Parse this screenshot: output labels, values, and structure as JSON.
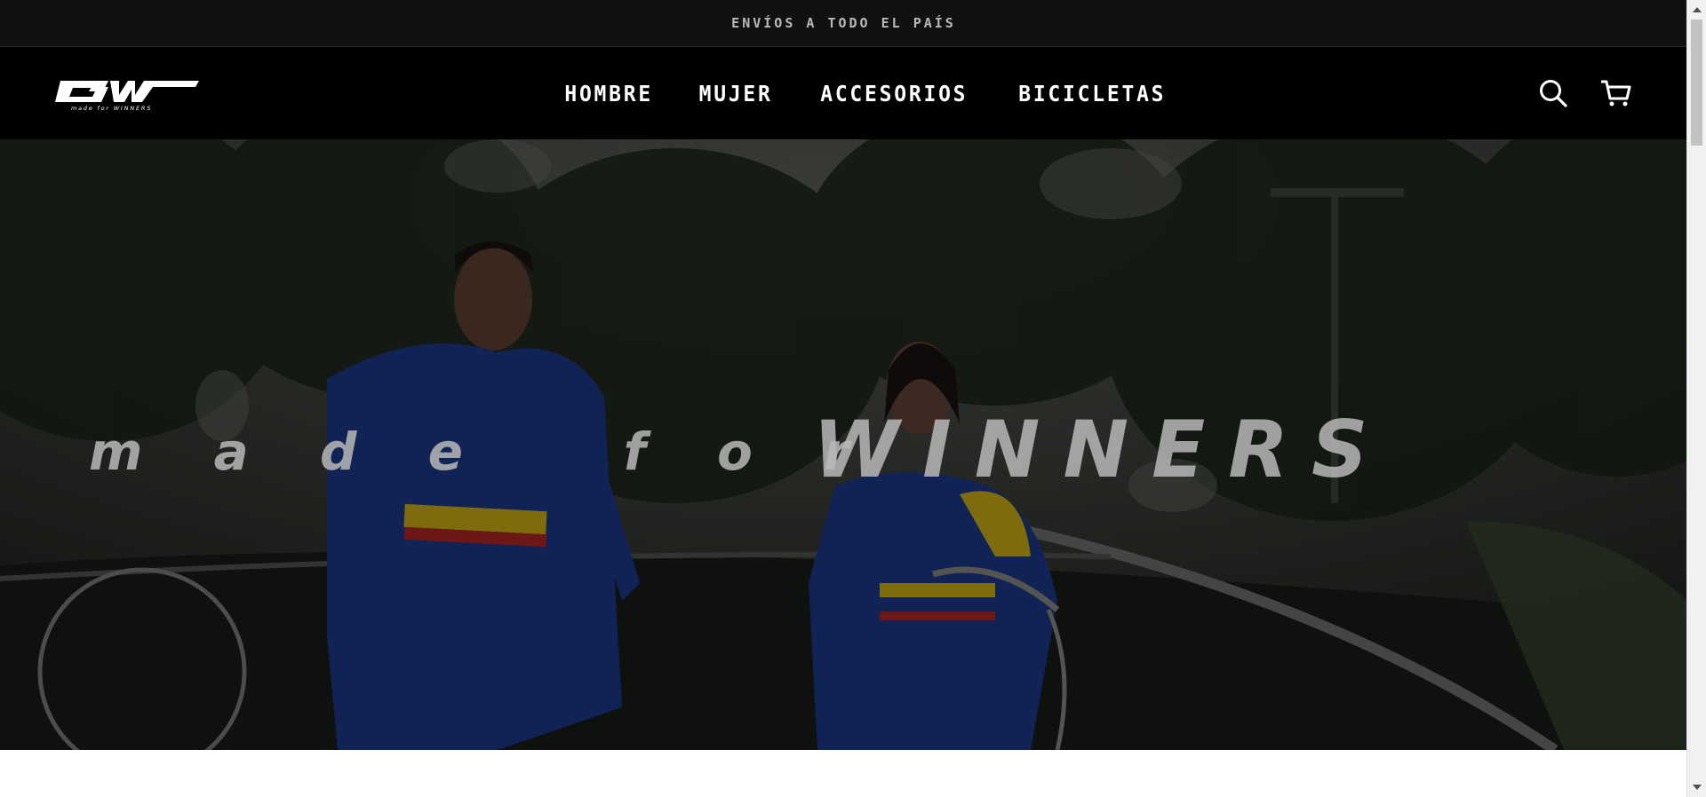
{
  "announcement": "ENVÍOS A TODO EL PAÍS",
  "logo": {
    "text": "GW",
    "tagline": "made for WINNERS"
  },
  "nav": {
    "items": [
      "HOMBRE",
      "MUJER",
      "ACCESORIOS",
      "BICICLETAS"
    ]
  },
  "header_icons": {
    "search": "search-icon",
    "cart": "cart-icon"
  },
  "hero": {
    "made_for": "m a d e   f o r",
    "winners": "WINNERS",
    "overlay_color": "#000000"
  },
  "colors": {
    "topbar": "#111111",
    "header": "#000000",
    "jersey_blue": "#1f3f9a",
    "flag_yellow": "#e6c41a",
    "flag_red": "#c62b2b"
  }
}
